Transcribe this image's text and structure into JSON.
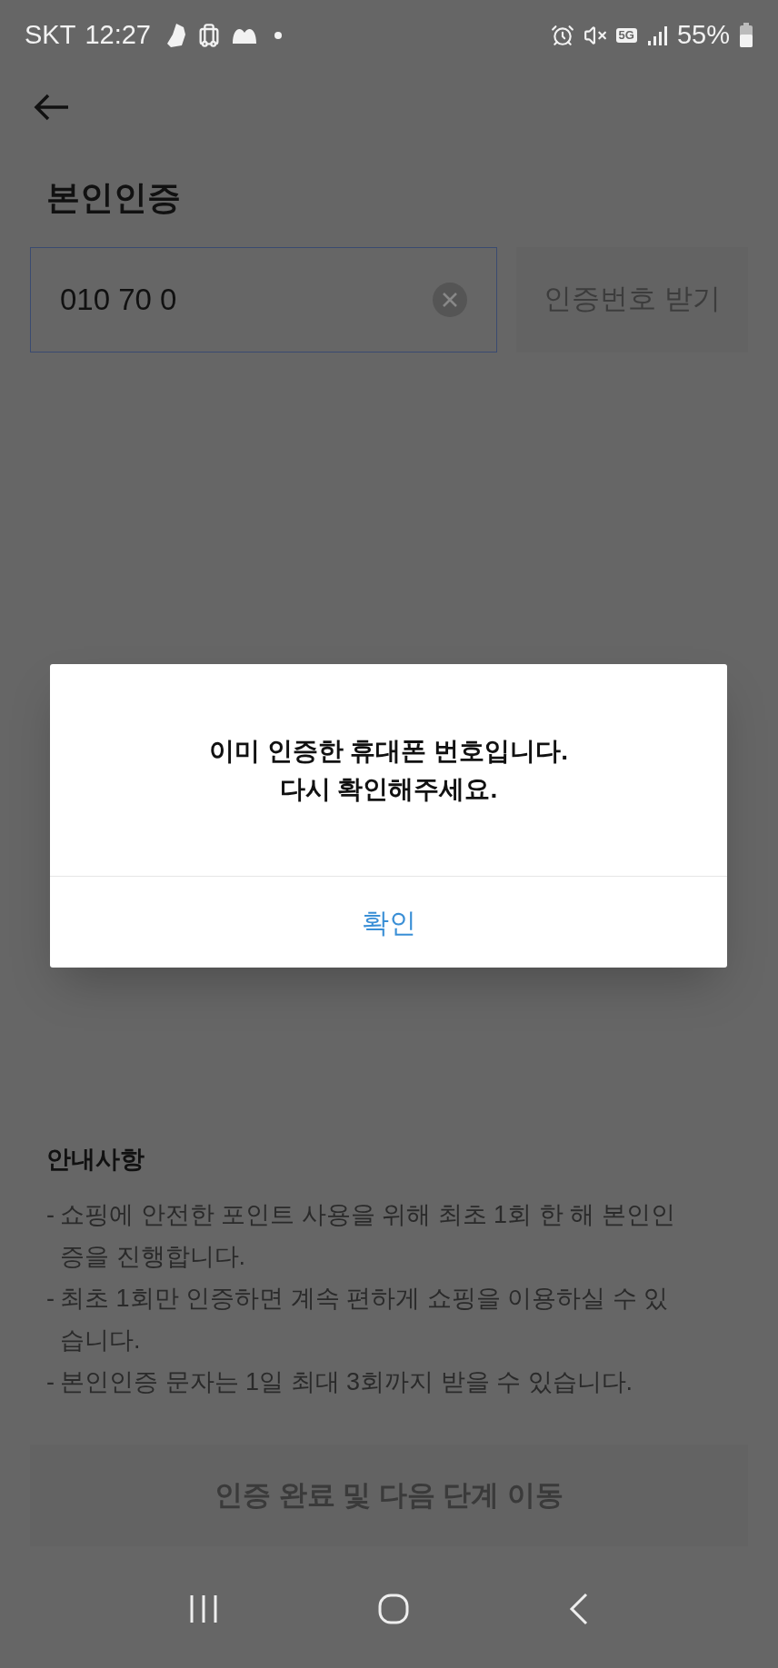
{
  "status_bar": {
    "carrier": "SKT",
    "time": "12:27",
    "network": "5G",
    "battery": "55%"
  },
  "header": {
    "title": "본인인증"
  },
  "phone_field": {
    "value": "010 70 0",
    "focused": true
  },
  "request_button": {
    "label": "인증번호 받기",
    "disabled": true
  },
  "notice": {
    "title": "안내사항",
    "items": [
      {
        "dash": "-",
        "text": "쇼핑에 안전한 포인트 사용을 위해 최초 1회 한 해 본인인증을 진행합니다."
      },
      {
        "dash": "-",
        "text": "최초 1회만 인증하면 계속 편하게 쇼핑을 이용하실 수 있습니다."
      },
      {
        "dash": "-",
        "text": "본인인증 문자는 1일 최대 3회까지 받을 수 있습니다."
      }
    ]
  },
  "next_button": {
    "label": "인증 완료 및 다음 단계 이동",
    "disabled": true
  },
  "dialog": {
    "lines": [
      "이미 인증한 휴대폰 번호입니다.",
      "다시 확인해주세요."
    ],
    "button": "확인"
  }
}
